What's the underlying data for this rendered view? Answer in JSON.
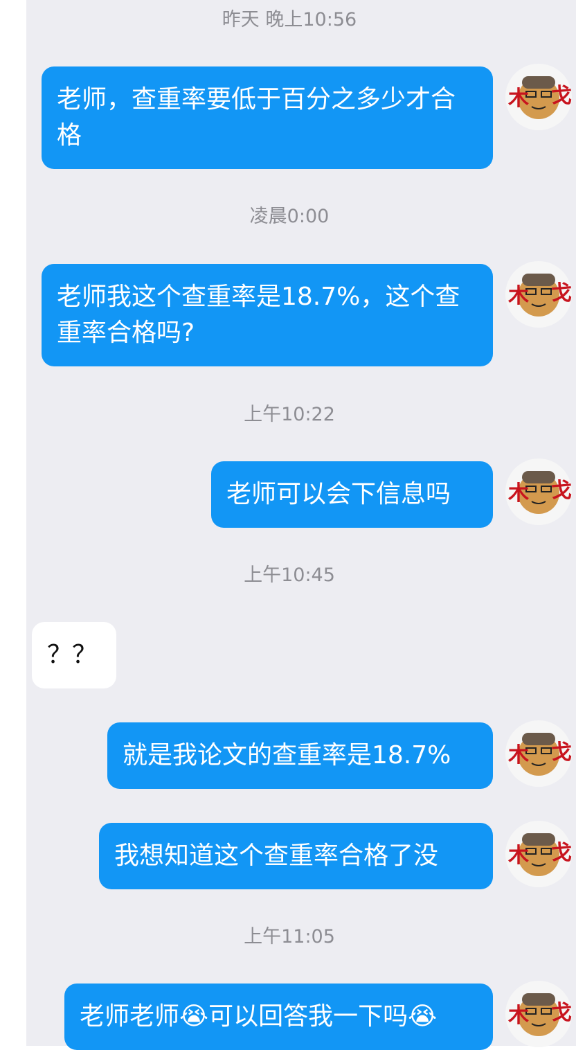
{
  "messages": {
    "ts1": "昨天 晚上10:56",
    "m1": "老师，查重率要低于百分之多少才合格",
    "ts2": "凌晨0:00",
    "m2": "老师我这个查重率是18.7%，这个查重率合格吗?",
    "ts3": "上午10:22",
    "m3": "老师可以会下信息吗",
    "ts4": "上午10:45",
    "m4": "？？",
    "m5": "就是我论文的查重率是18.7%",
    "m6": "我想知道这个查重率合格了没",
    "ts5": "上午11:05",
    "m7": "老师老师😭可以回答我一下吗😭"
  },
  "avatar_icon": "cartoon-face-avatar-icon",
  "colors": {
    "chat_bg": "#ededf2",
    "sent_bubble": "#1296f5",
    "received_bubble": "#ffffff",
    "timestamp": "#8d8d93"
  }
}
